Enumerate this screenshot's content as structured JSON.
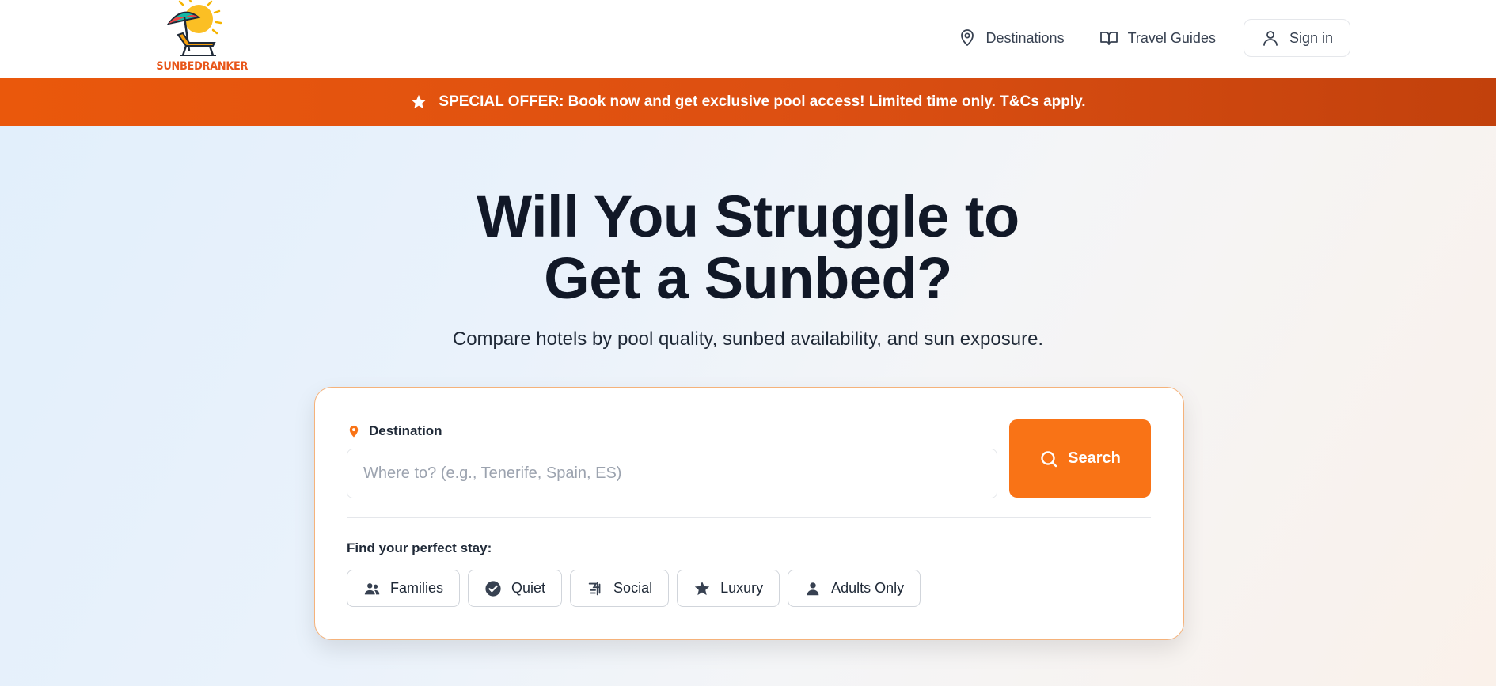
{
  "brand": {
    "name": "SUNBEDRANKER"
  },
  "nav": {
    "destinations": "Destinations",
    "travel_guides": "Travel Guides",
    "sign_in": "Sign in"
  },
  "promo": {
    "text": "SPECIAL OFFER: Book now and get exclusive pool access! Limited time only. T&Cs apply.",
    "icon": "star-icon"
  },
  "hero": {
    "title_line1": "Will You Struggle to",
    "title_line2": "Get a Sunbed?",
    "subtitle": "Compare hotels by pool quality, sunbed availability, and sun exposure."
  },
  "search": {
    "destination_label": "Destination",
    "placeholder": "Where to? (e.g., Tenerife, Spain, ES)",
    "value": "",
    "button_label": "Search"
  },
  "filters": {
    "label": "Find your perfect stay:",
    "chips": [
      {
        "label": "Families",
        "icon": "people-icon"
      },
      {
        "label": "Quiet",
        "icon": "check-circle-icon"
      },
      {
        "label": "Social",
        "icon": "social-icon"
      },
      {
        "label": "Luxury",
        "icon": "star-icon"
      },
      {
        "label": "Adults Only",
        "icon": "person-icon"
      }
    ]
  },
  "colors": {
    "accent": "#f97316",
    "banner": "#e8561a",
    "title": "#111827",
    "card_border": "#f5b27a"
  }
}
